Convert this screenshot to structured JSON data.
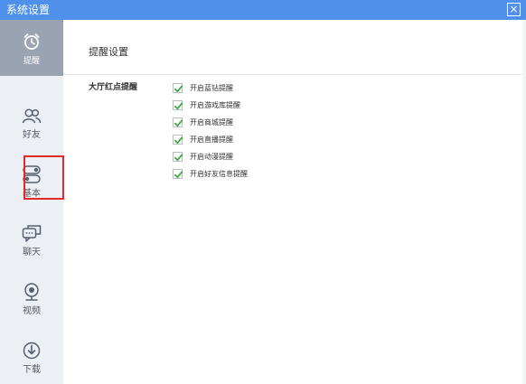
{
  "window": {
    "title": "系统设置",
    "close_glyph": "×"
  },
  "sidebar": {
    "items": [
      {
        "label": "提醒",
        "icon": "alarm-clock-icon",
        "active": true
      },
      {
        "label": "好友",
        "icon": "friends-icon",
        "active": false
      },
      {
        "label": "基本",
        "icon": "toggle-switch-icon",
        "active": false,
        "highlighted": true
      },
      {
        "label": "聊天",
        "icon": "chat-bubbles-icon",
        "active": false
      },
      {
        "label": "视频",
        "icon": "webcam-icon",
        "active": false
      },
      {
        "label": "下载",
        "icon": "download-icon",
        "active": false
      }
    ]
  },
  "content": {
    "section_title": "提醒设置",
    "group_label": "大厅红点提醒",
    "options": [
      {
        "label": "开启蓝钻提醒",
        "checked": true
      },
      {
        "label": "开启游戏库提醒",
        "checked": true
      },
      {
        "label": "开启商城提醒",
        "checked": true
      },
      {
        "label": "开启直播提醒",
        "checked": true
      },
      {
        "label": "开启动漫提醒",
        "checked": true
      },
      {
        "label": "开启好友信息提醒",
        "checked": true
      }
    ]
  },
  "colors": {
    "titlebar": "#4f90ea",
    "sidebar_bg": "#eceff4",
    "sidebar_active": "#9aa3b2",
    "check_green": "#3aa73a",
    "highlight_red": "#e02b2b"
  }
}
